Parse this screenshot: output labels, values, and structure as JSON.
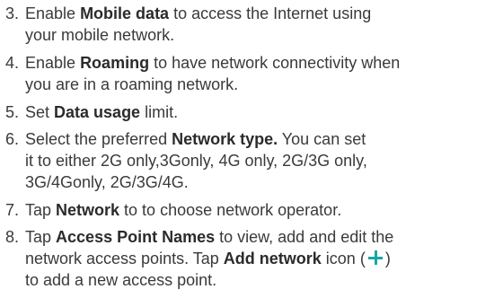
{
  "steps": [
    {
      "num": "3.",
      "lines": [
        {
          "pre": "Enable ",
          "bold": "Mobile data",
          "post": " to access the Internet using"
        },
        {
          "pre": "your mobile network.",
          "bold": "",
          "post": ""
        }
      ]
    },
    {
      "num": "4.",
      "lines": [
        {
          "pre": "Enable ",
          "bold": "Roaming",
          "post": " to have network connectivity when"
        },
        {
          "pre": "you are in a roaming network.",
          "bold": "",
          "post": ""
        }
      ]
    },
    {
      "num": "5.",
      "lines": [
        {
          "pre": "Set ",
          "bold": "Data usage",
          "post": " limit."
        }
      ]
    },
    {
      "num": "6.",
      "lines": [
        {
          "pre": "Select the preferred ",
          "bold": "Network type.",
          "post": " You can set"
        },
        {
          "pre": "it to either 2G only,3Gonly, 4G only, 2G/3G only,",
          "bold": "",
          "post": ""
        },
        {
          "pre": "3G/4Gonly, 2G/3G/4G.",
          "bold": "",
          "post": ""
        }
      ]
    },
    {
      "num": "7.",
      "lines": [
        {
          "pre": "Tap ",
          "bold": "Network",
          "post": " to to choose network operator."
        }
      ]
    },
    {
      "num": "8.",
      "lines": [
        {
          "pre": "Tap ",
          "bold": "Access Point Names",
          "post": " to view, add and edit the"
        },
        {
          "pre": "network access points. Tap ",
          "bold": "Add network",
          "post": " icon ("
        },
        {
          "pre": "to add a new access point.",
          "bold": "",
          "post": ""
        }
      ],
      "icon_after_line": 1,
      "icon_name": "plus-icon",
      "icon_color": "#16a6a6",
      "icon_trailer": ")"
    }
  ]
}
